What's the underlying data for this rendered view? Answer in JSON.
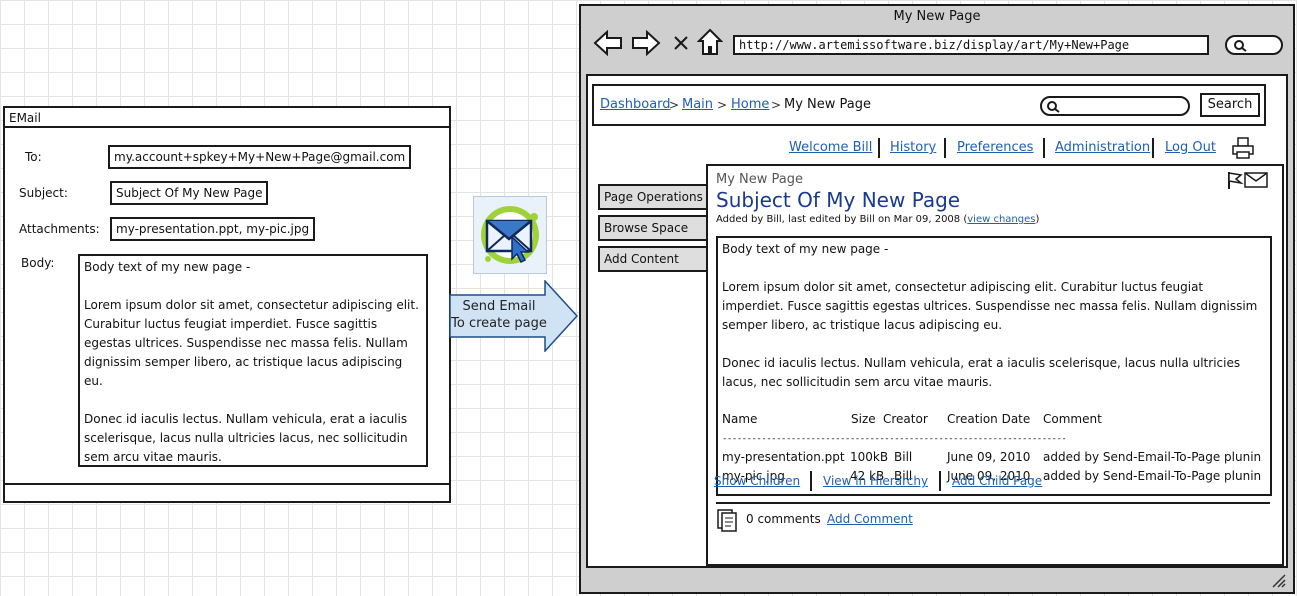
{
  "email": {
    "window_title": "EMail",
    "to_label": "To:",
    "to_value": "my.account+spkey+My+New+Page@gmail.com",
    "subject_label": "Subject:",
    "subject_value": "Subject Of My New Page",
    "attachments_label": "Attachments:",
    "attachments_value": "my-presentation.ppt, my-pic.jpg",
    "body_label": "Body:",
    "body_paragraphs": [
      "Body text of my new page -",
      "Lorem ipsum dolor sit amet, consectetur adipiscing elit. Curabitur luctus feugiat imperdiet. Fusce sagittis egestas ultrices. Suspendisse nec massa felis. Nullam dignissim semper libero, ac tristique lacus adipiscing eu.",
      "Donec id iaculis lectus. Nullam vehicula, erat a iaculis scelerisque, lacus nulla ultricies lacus, nec sollicitudin sem arcu vitae mauris."
    ]
  },
  "middle": {
    "icon": "mail-envelope-cursor-icon",
    "arrow_label_line1": "Send Email",
    "arrow_label_line2": "To create page"
  },
  "browser": {
    "title": "My New Page",
    "url": "http://www.artemissoftware.biz/display/art/My+New+Page",
    "nav_icons": [
      "back-arrow-icon",
      "forward-arrow-icon",
      "stop-icon",
      "home-icon",
      "search-icon"
    ],
    "breadcrumbs": [
      "Dashboard",
      "Main",
      "Home",
      "My New Page"
    ],
    "breadcrumb_separator": ">",
    "search_button": "Search",
    "user_menu": [
      "Welcome Bill",
      "History",
      "Preferences",
      "Administration",
      "Log Out"
    ],
    "sidebar": [
      "Page Operations",
      "Browse Space",
      "Add Content"
    ],
    "page": {
      "space_name": "My New Page",
      "title": "Subject Of My New Page",
      "meta_prefix": "Added by Bill, last edited by Bill on Mar 09, 2008 (",
      "meta_link": "view changes",
      "meta_suffix": ")",
      "paragraphs": [
        "Body text of my new page -",
        "Lorem ipsum dolor sit amet, consectetur adipiscing elit. Curabitur luctus feugiat imperdiet. Fusce sagittis egestas ultrices. Suspendisse nec massa felis. Nullam dignissim semper libero, ac tristique lacus adipiscing eu.",
        "Donec id iaculis lectus. Nullam vehicula, erat a iaculis scelerisque, lacus nulla ultricies lacus, nec sollicitudin sem arcu vitae mauris."
      ],
      "table_headers": [
        "Name",
        "Size",
        "Creator",
        "Creation Date",
        "Comment"
      ],
      "table_rule": "----------------------------------------------------------------------",
      "table_rows": [
        [
          "my-presentation.ppt",
          "100kB",
          "Bill",
          "June 09, 2010",
          "added by Send-Email-To-Page plunin"
        ],
        [
          "my-pic.jpg",
          "42 kB",
          "Bill",
          "June 09, 2010",
          "added by Send-Email-To-Page plunin"
        ]
      ],
      "bottom_links": [
        "Show Children",
        "View in Hierarchy",
        "Add Child Page"
      ],
      "comments_count": "0 comments",
      "add_comment": "Add Comment"
    }
  },
  "colors": {
    "link": "#1f5fb0",
    "title": "#1a3a8c",
    "chrome": "#cfcfcf",
    "arrow": "#cfe3f5"
  }
}
